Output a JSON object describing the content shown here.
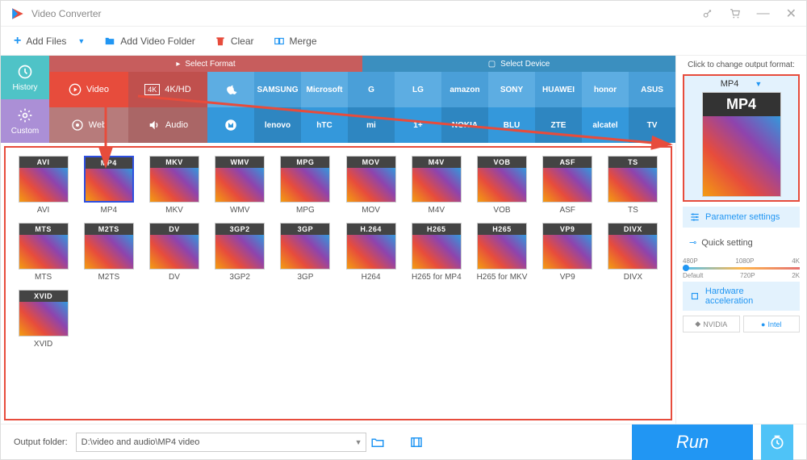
{
  "app": {
    "title": "Video Converter"
  },
  "toolbar": {
    "add_files": "Add Files",
    "add_folder": "Add Video Folder",
    "clear": "Clear",
    "merge": "Merge"
  },
  "leftcol": {
    "history": "History",
    "custom": "Custom"
  },
  "tabs": {
    "select_format": "Select Format",
    "select_device": "Select Device"
  },
  "categories": {
    "video": "Video",
    "k4": "4K/HD",
    "web": "Web",
    "audio": "Audio"
  },
  "brands_row1": [
    "",
    "SAMSUNG",
    "Microsoft",
    "G",
    "LG",
    "amazon",
    "SONY",
    "HUAWEI",
    "honor",
    "ASUS"
  ],
  "brands_row2": [
    "",
    "lenovo",
    "hTC",
    "mi",
    "1+",
    "NOKIA",
    "BLU",
    "ZTE",
    "alcatel",
    "TV"
  ],
  "formats": [
    {
      "badge": "AVI",
      "label": "AVI"
    },
    {
      "badge": "MP4",
      "label": "MP4",
      "selected": true
    },
    {
      "badge": "MKV",
      "label": "MKV"
    },
    {
      "badge": "WMV",
      "label": "WMV"
    },
    {
      "badge": "MPG",
      "label": "MPG"
    },
    {
      "badge": "MOV",
      "label": "MOV"
    },
    {
      "badge": "M4V",
      "label": "M4V"
    },
    {
      "badge": "VOB",
      "label": "VOB"
    },
    {
      "badge": "ASF",
      "label": "ASF"
    },
    {
      "badge": "TS",
      "label": "TS"
    },
    {
      "badge": "MTS",
      "label": "MTS"
    },
    {
      "badge": "M2TS",
      "label": "M2TS"
    },
    {
      "badge": "DV",
      "label": "DV"
    },
    {
      "badge": "3GP2",
      "label": "3GP2"
    },
    {
      "badge": "3GP",
      "label": "3GP"
    },
    {
      "badge": "H.264",
      "label": "H264"
    },
    {
      "badge": "H265",
      "label": "H265 for MP4"
    },
    {
      "badge": "H265",
      "label": "H265 for MKV"
    },
    {
      "badge": "VP9",
      "label": "VP9"
    },
    {
      "badge": "DIVX",
      "label": "DIVX"
    },
    {
      "badge": "XVID",
      "label": "XVID"
    }
  ],
  "sidebar": {
    "change_format": "Click to change output format:",
    "current_format": "MP4",
    "param_settings": "Parameter settings",
    "quick_setting": "Quick setting",
    "quality_ticks_top": [
      "480P",
      "1080P",
      "4K"
    ],
    "quality_ticks_bottom": [
      "Default",
      "720P",
      "2K"
    ],
    "hw_accel": "Hardware acceleration",
    "nvidia": "NVIDIA",
    "intel": "Intel"
  },
  "bottom": {
    "output_label": "Output folder:",
    "output_path": "D:\\video and audio\\MP4 video",
    "run": "Run"
  }
}
